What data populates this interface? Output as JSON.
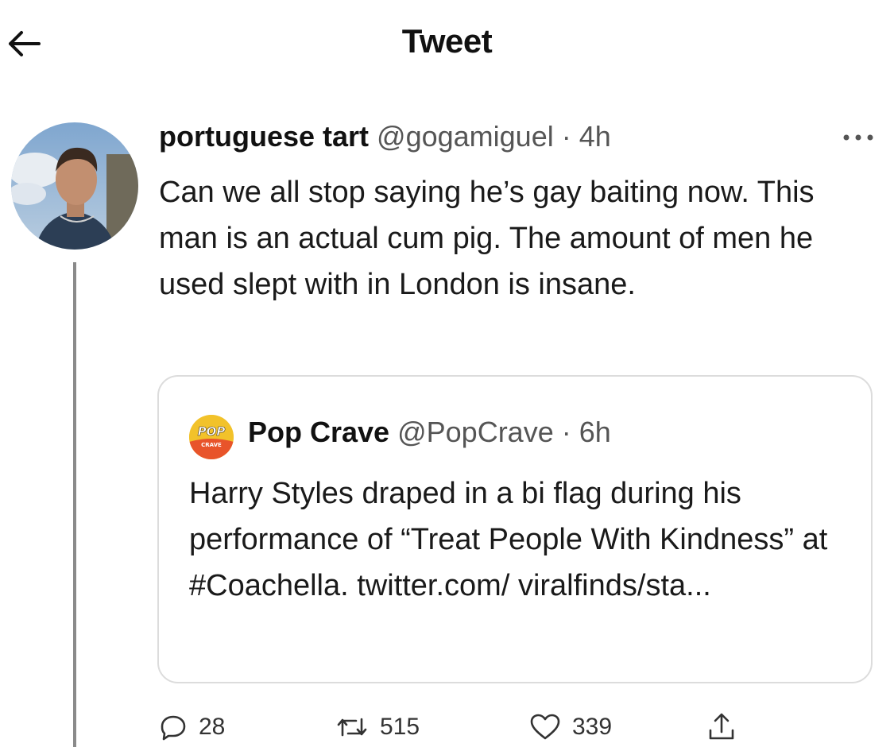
{
  "header": {
    "back_icon": "arrow-left-icon",
    "title": "Tweet"
  },
  "tweet": {
    "display_name": "portuguese tart",
    "handle": "@gogamiguel",
    "separator": "·",
    "time": "4h",
    "text": "Can we all stop saying he’s gay baiting now. This man is an actual cum pig. The amount of men he used slept with in London is insane.",
    "more_icon": "more-dots-icon"
  },
  "quote": {
    "display_name": "Pop Crave",
    "handle": "@PopCrave",
    "separator": "·",
    "time": "6h",
    "avatar_text": "POP",
    "avatar_subtext": "CRAVE",
    "text": "Harry Styles draped in a bi flag during his performance of “Treat People With Kindness” at #Coachella. twitter.com/ viralfinds/sta..."
  },
  "actions": {
    "replies": "28",
    "retweets": "515",
    "likes": "339",
    "icons": [
      "reply-icon",
      "retweet-icon",
      "like-icon",
      "share-icon"
    ]
  },
  "colors": {
    "text": "#111111",
    "muted": "#555555",
    "border": "#dcdcdc",
    "thread_line": "#8a8a8a",
    "quote_avatar": "#f2c22a"
  }
}
